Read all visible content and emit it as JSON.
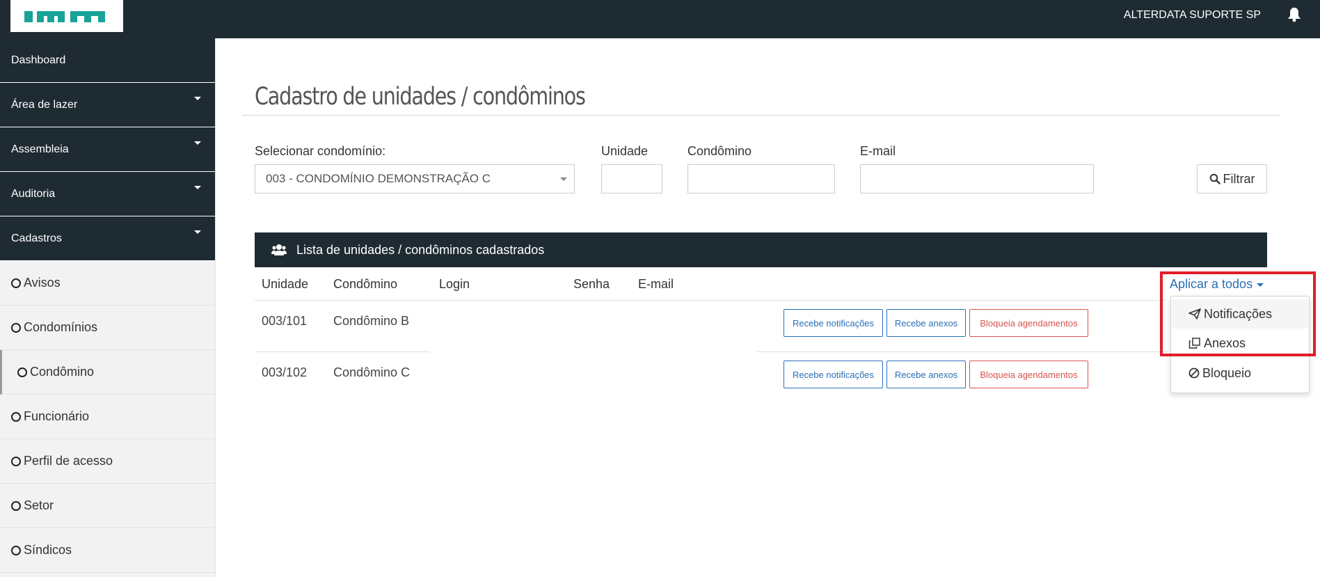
{
  "header": {
    "user_name": "ALTERDATA SUPORTE SP",
    "logo_icon": "im-logo",
    "notification_icon": "bell-icon"
  },
  "sidebar": {
    "main_items": [
      {
        "label": "Dashboard",
        "has_caret": false
      },
      {
        "label": "Área de lazer",
        "has_caret": true
      },
      {
        "label": "Assembleia",
        "has_caret": true
      },
      {
        "label": "Auditoria",
        "has_caret": true
      },
      {
        "label": "Cadastros",
        "has_caret": true
      }
    ],
    "sub_items": [
      {
        "label": "Avisos"
      },
      {
        "label": "Condomínios"
      },
      {
        "label": "Condômino",
        "active": true
      },
      {
        "label": "Funcionário"
      },
      {
        "label": "Perfil de acesso"
      },
      {
        "label": "Setor"
      },
      {
        "label": "Síndicos"
      }
    ]
  },
  "page": {
    "title": "Cadastro de unidades / condôminos"
  },
  "filters": {
    "select_label": "Selecionar condomínio:",
    "select_value": "003 - CONDOMÍNIO DEMONSTRAÇÃO C",
    "unidade_label": "Unidade",
    "unidade_value": "",
    "condomino_label": "Condômino",
    "condomino_value": "",
    "email_label": "E-mail",
    "email_value": "",
    "filter_button": "Filtrar"
  },
  "list": {
    "header": "Lista de unidades / condôminos cadastrados",
    "columns": [
      "Unidade",
      "Condômino",
      "Login",
      "Senha",
      "E-mail"
    ],
    "rows": [
      {
        "unidade": "003/101",
        "condomino": "Condômino B",
        "login": "",
        "senha": "",
        "email": ""
      },
      {
        "unidade": "003/102",
        "condomino": "Condômino C",
        "login": "",
        "senha": "",
        "email": ""
      }
    ],
    "row_actions": {
      "notifications": "Recebe notificações",
      "attachments": "Recebe anexos",
      "block": "Bloqueia agendamentos"
    },
    "apply_all": {
      "label": "Aplicar a todos",
      "options": [
        "Notificações",
        "Anexos",
        "Bloqueio"
      ]
    }
  },
  "colors": {
    "dark": "#1f2b33",
    "link": "#2a6fb5",
    "danger": "#d9534f",
    "highlight": "#e11d2a"
  }
}
